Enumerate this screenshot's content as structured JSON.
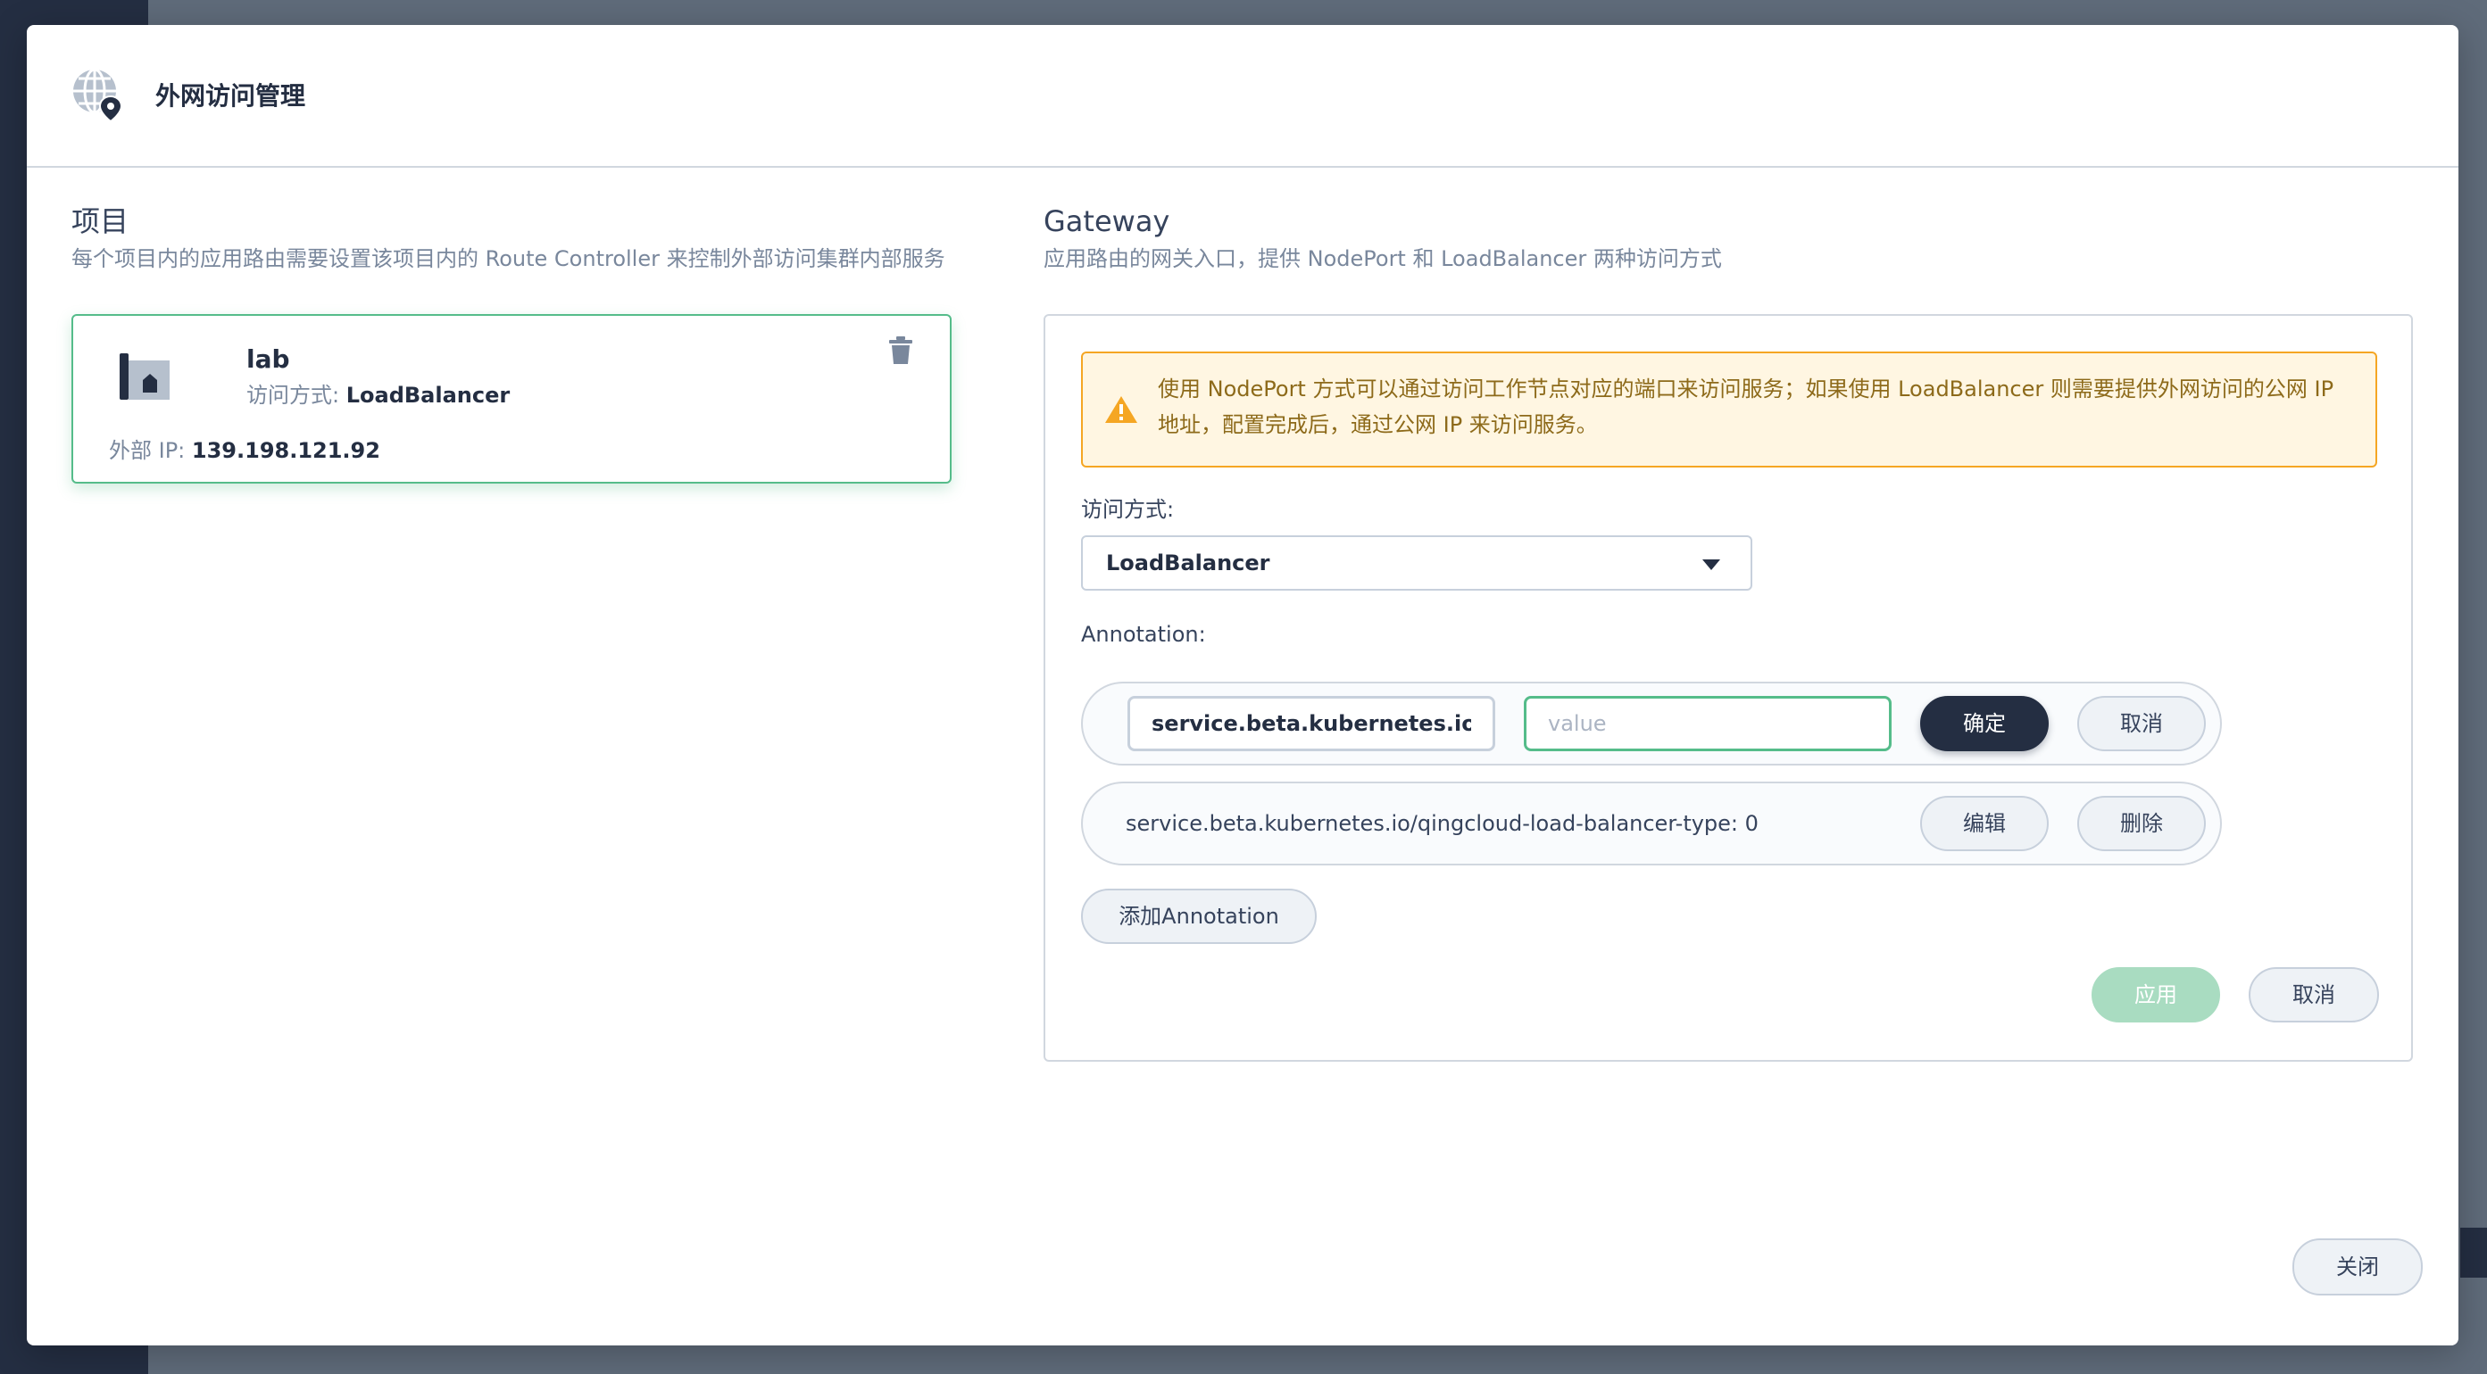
{
  "modal": {
    "title": "外网访问管理"
  },
  "project_section": {
    "title": "项目",
    "description": "每个项目内的应用路由需要设置该项目内的 Route Controller 来控制外部访问集群内部服务",
    "card": {
      "name": "lab",
      "access_label": "访问方式: ",
      "access_value": "LoadBalancer",
      "ip_label": "外部 IP: ",
      "ip_value": "139.198.121.92"
    }
  },
  "gateway_section": {
    "title": "Gateway",
    "description": "应用路由的网关入口，提供 NodePort 和 LoadBalancer 两种访问方式",
    "warning": "使用 NodePort 方式可以通过访问工作节点对应的端口来访问服务；如果使用 LoadBalancer 则需要提供外网访问的公网 IP 地址，配置完成后，通过公网 IP 来访问服务。",
    "access_label": "访问方式:",
    "access_selected": "LoadBalancer",
    "annotation_label": "Annotation:",
    "edit_row": {
      "key_value": "service.beta.kubernetes.io/qingcloud-load-balancer-eip-ids",
      "value_placeholder": "value",
      "confirm_label": "确定",
      "cancel_label": "取消"
    },
    "annotations": [
      {
        "text": "service.beta.kubernetes.io/qingcloud-load-balancer-type: 0",
        "edit_label": "编辑",
        "delete_label": "删除"
      }
    ],
    "add_annotation_label": "添加Annotation",
    "apply_label": "应用",
    "cancel_label": "取消"
  },
  "footer": {
    "close_label": "关闭"
  }
}
